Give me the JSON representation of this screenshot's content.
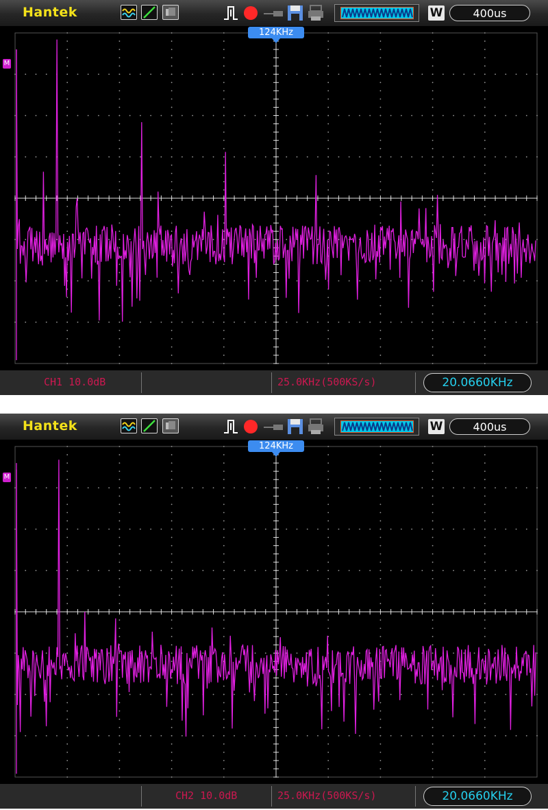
{
  "colors": {
    "trace": "#e020e0",
    "grid": "#9a9a9a",
    "brand": "#f4e21a",
    "readout": "#25d0ee",
    "status_text": "#cc1850",
    "trigger_marker": "#3c8cf0"
  },
  "screens": [
    {
      "brand": "Hantek",
      "icons": [
        "waveform-icon",
        "trigger-slope-icon",
        "persistence-icon",
        "pulse-icon",
        "record-icon",
        "probe-icon",
        "save-icon",
        "print-icon"
      ],
      "timebase_mode": "W",
      "timebase": "400us",
      "trigger_marker": "124KHz",
      "channel_marker": "M",
      "channel_label": "CH1 10.0dB",
      "freq_info": "25.0KHz(500KS/s)",
      "cursor_readout": "20.0660KHz",
      "trace_seed": 7,
      "noise_floor": 0.64,
      "peaks": [
        {
          "f": 0.0,
          "level": 0.05
        },
        {
          "f": 0.052,
          "level": 0.42
        },
        {
          "f": 0.078,
          "level": 0.02
        },
        {
          "f": 0.116,
          "level": 0.5
        },
        {
          "f": 0.242,
          "level": 0.27
        },
        {
          "f": 0.272,
          "level": 0.48
        },
        {
          "f": 0.403,
          "level": 0.36
        },
        {
          "f": 0.577,
          "level": 0.43
        },
        {
          "f": 0.741,
          "level": 0.51
        },
        {
          "f": 0.811,
          "level": 0.49
        }
      ]
    },
    {
      "brand": "Hantek",
      "icons": [
        "waveform-icon",
        "trigger-slope-icon",
        "persistence-icon",
        "pulse-icon",
        "record-icon",
        "probe-icon",
        "save-icon",
        "print-icon"
      ],
      "timebase_mode": "W",
      "timebase": "400us",
      "trigger_marker": "124KHz",
      "channel_marker": "M",
      "channel_label": "CH2 10.0dB",
      "freq_info": "25.0KHz(500KS/s)",
      "cursor_readout": "20.0660KHz",
      "trace_seed": 19,
      "noise_floor": 0.66,
      "peaks": [
        {
          "f": 0.0,
          "level": 0.07
        },
        {
          "f": 0.081,
          "level": 0.04
        },
        {
          "f": 0.132,
          "level": 0.5
        },
        {
          "f": 0.192,
          "level": 0.52
        }
      ]
    }
  ]
}
